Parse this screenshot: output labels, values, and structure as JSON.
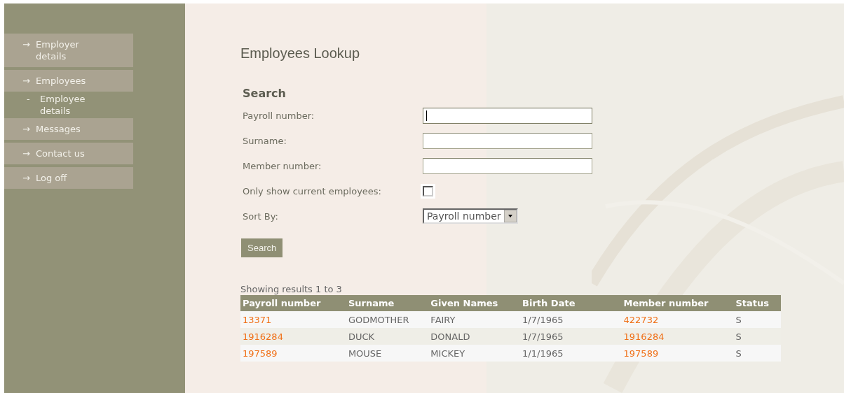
{
  "sidebar": {
    "items": [
      {
        "kind": "link",
        "icon": "→",
        "label": "Employer details"
      },
      {
        "kind": "link",
        "icon": "→",
        "label": "Employees"
      },
      {
        "kind": "sublink",
        "icon": "-",
        "label": "Employee details"
      },
      {
        "kind": "link",
        "icon": "→",
        "label": "Messages"
      },
      {
        "kind": "link",
        "icon": "→",
        "label": "Contact us"
      },
      {
        "kind": "link",
        "icon": "→",
        "label": "Log off"
      }
    ]
  },
  "title": "Employees Lookup",
  "search": {
    "heading": "Search",
    "fields": [
      {
        "kind": "text",
        "label": "Payroll number:",
        "focused": true
      },
      {
        "kind": "text",
        "label": "Surname:",
        "focused": false
      },
      {
        "kind": "text",
        "label": "Member number:",
        "focused": false
      },
      {
        "kind": "checkbox",
        "label": "Only show current employees:",
        "checked": false
      },
      {
        "kind": "select",
        "label": "Sort By:",
        "value": "Payroll number"
      }
    ],
    "button": "Search"
  },
  "results": {
    "summary": "Showing results 1 to 3",
    "columns": [
      "Payroll number",
      "Surname",
      "Given Names",
      "Birth Date",
      "Member number",
      "Status"
    ],
    "rows": [
      [
        "13371",
        "GODMOTHER",
        "FAIRY",
        "1/7/1965",
        "422732",
        "S"
      ],
      [
        "1916284",
        "DUCK",
        "DONALD",
        "1/7/1965",
        "1916284",
        "S"
      ],
      [
        "197589",
        "MOUSE",
        "MICKEY",
        "1/1/1965",
        "197589",
        "S"
      ]
    ]
  }
}
